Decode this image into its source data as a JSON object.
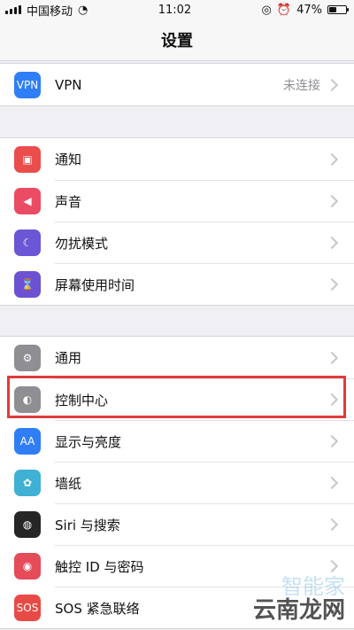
{
  "status_bar": {
    "carrier": "中国移动",
    "time": "11:02",
    "battery": "47%",
    "battery_level": 0.47
  },
  "nav": {
    "title": "设置"
  },
  "groups": [
    {
      "rows": [
        {
          "label": "VPN",
          "value": "未连接",
          "icon": "vpn-icon",
          "color": "#2f7ef6"
        }
      ]
    },
    {
      "rows": [
        {
          "label": "通知",
          "icon": "notification-icon",
          "color": "#ea4d4b"
        },
        {
          "label": "声音",
          "icon": "speaker-icon",
          "color": "#eb4b65"
        },
        {
          "label": "勿扰模式",
          "icon": "moon-icon",
          "color": "#6b56d6"
        },
        {
          "label": "屏幕使用时间",
          "icon": "hourglass-icon",
          "color": "#6c52d3"
        }
      ]
    },
    {
      "rows": [
        {
          "label": "通用",
          "icon": "gear-icon",
          "color": "#8e8e93"
        },
        {
          "label": "控制中心",
          "icon": "toggle-icon",
          "color": "#8e8e93"
        },
        {
          "label": "显示与亮度",
          "icon": "text-size-icon",
          "color": "#2f7ef6"
        },
        {
          "label": "墙纸",
          "icon": "flower-icon",
          "color": "#3fb1d4"
        },
        {
          "label": "Siri 与搜索",
          "icon": "siri-icon",
          "color": "#262626"
        },
        {
          "label": "触控 ID 与密码",
          "icon": "fingerprint-icon",
          "color": "#e64b59"
        },
        {
          "label": "SOS 紧急联络",
          "icon": "sos-icon",
          "color": "#e84b46"
        }
      ]
    }
  ],
  "watermark": {
    "main": "云南龙网",
    "secondary": "智能家"
  }
}
